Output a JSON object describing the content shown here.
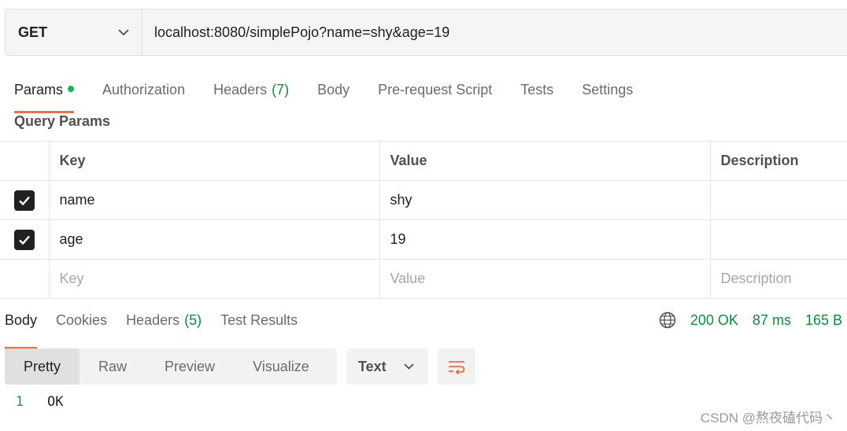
{
  "request": {
    "method": "GET",
    "url": "localhost:8080/simplePojo?name=shy&age=19"
  },
  "request_tabs": [
    {
      "label": "Params",
      "active": true,
      "dot": true
    },
    {
      "label": "Authorization"
    },
    {
      "label": "Headers",
      "count": "(7)"
    },
    {
      "label": "Body"
    },
    {
      "label": "Pre-request Script"
    },
    {
      "label": "Tests"
    },
    {
      "label": "Settings"
    }
  ],
  "query_params": {
    "title": "Query Params",
    "columns": [
      "Key",
      "Value",
      "Description"
    ],
    "rows": [
      {
        "checked": true,
        "key": "name",
        "value": "shy",
        "description": ""
      },
      {
        "checked": true,
        "key": "age",
        "value": "19",
        "description": ""
      }
    ],
    "placeholders": {
      "key": "Key",
      "value": "Value",
      "description": "Description"
    }
  },
  "response_tabs": [
    {
      "label": "Body",
      "active": true
    },
    {
      "label": "Cookies"
    },
    {
      "label": "Headers",
      "count": "(5)"
    },
    {
      "label": "Test Results"
    }
  ],
  "response_status": {
    "status": "200 OK",
    "time": "87 ms",
    "size": "165 B"
  },
  "view_modes": [
    {
      "label": "Pretty",
      "active": true
    },
    {
      "label": "Raw"
    },
    {
      "label": "Preview"
    },
    {
      "label": "Visualize"
    }
  ],
  "format": "Text",
  "body_lines": [
    {
      "number": "1",
      "text": "OK"
    }
  ],
  "watermark": "CSDN @熬夜磕代码丶",
  "colors": {
    "accent": "#ff6c37",
    "success": "#0a8f3a",
    "dot": "#0cbb52"
  }
}
